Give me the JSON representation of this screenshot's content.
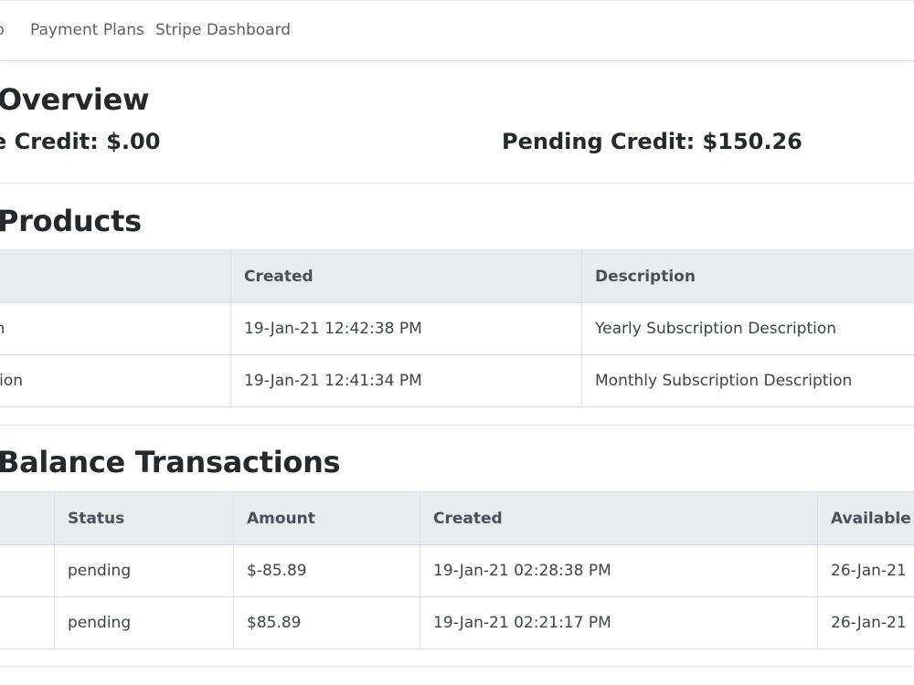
{
  "nav": {
    "items": [
      {
        "label": "p"
      },
      {
        "label": "Payment Plans"
      },
      {
        "label": "Stripe Dashboard"
      }
    ]
  },
  "overview": {
    "title": "Overview",
    "available_credit": "Credit: $.00",
    "available_credit_prefix": "e",
    "pending_credit": "Pending Credit: $150.26"
  },
  "products": {
    "title": "Products",
    "columns": [
      "",
      "Created",
      "Description",
      ""
    ],
    "rows": [
      {
        "name": "cription",
        "created": "19-Jan-21 12:42:38 PM",
        "description": "Yearly Subscription Description"
      },
      {
        "name": "bscription",
        "created": "19-Jan-21 12:41:34 PM",
        "description": "Monthly Subscription Description"
      }
    ]
  },
  "balance": {
    "title": "Balance Transactions",
    "columns": [
      "",
      "Status",
      "Amount",
      "Created",
      "Available O"
    ],
    "rows": [
      {
        "id": "",
        "status": "pending",
        "amount": "$-85.89",
        "created": "19-Jan-21 02:28:38 PM",
        "available": "26-Jan-21"
      },
      {
        "id": "",
        "status": "pending",
        "amount": "$85.89",
        "created": "19-Jan-21 02:21:17 PM",
        "available": "26-Jan-21"
      }
    ]
  }
}
